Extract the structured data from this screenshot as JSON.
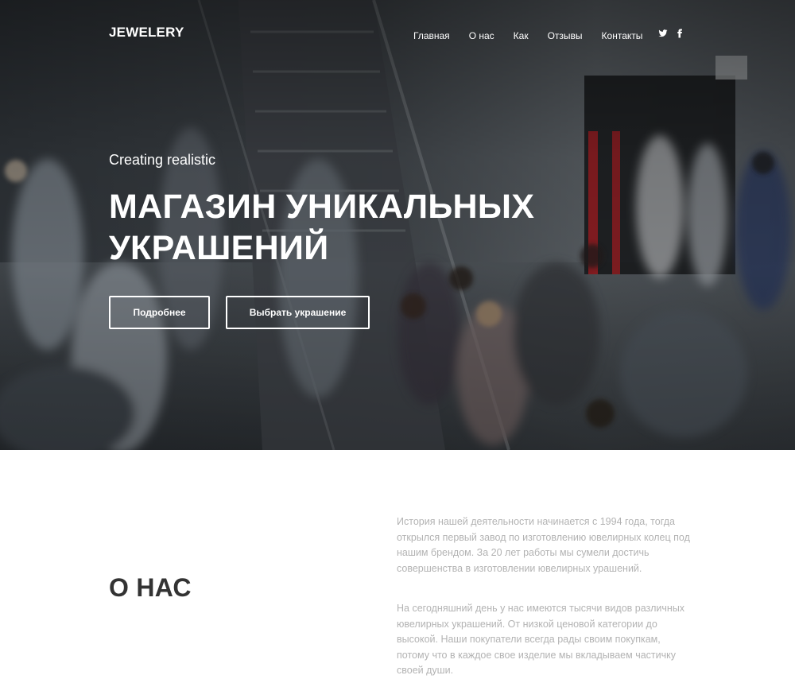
{
  "header": {
    "logo": "JEWELERY",
    "nav": [
      "Главная",
      "О нас",
      "Как",
      "Отзывы",
      "Контакты"
    ],
    "social": [
      "twitter-icon",
      "facebook-icon"
    ]
  },
  "hero": {
    "subtitle": "Creating realistic",
    "title": "МАГАЗИН УНИКАЛЬНЫХ УКРАШЕНИЙ",
    "buttons": {
      "more": "Подробнее",
      "choose": "Выбрать украшение"
    }
  },
  "about": {
    "title": "О НАС",
    "paragraphs": [
      "История нашей деятельности начинается с 1994 года, тогда открылся первый завод по изготовлению ювелирных колец под нашим брендом. За 20 лет работы мы сумели достичь совершенства в изготовлении ювелирных урашений.",
      "На сегодняшний день у нас имеются тысячи видов различных ювелирных украшений. От низкой ценовой категории до высокой. Наши покупатели всегда рады своим покупкам, потому что в каждое свое изделие мы вкладываем частичку своей души."
    ]
  },
  "colors": {
    "hero_text": "#ffffff",
    "about_title": "#333333",
    "about_text": "#b3b3b3"
  }
}
